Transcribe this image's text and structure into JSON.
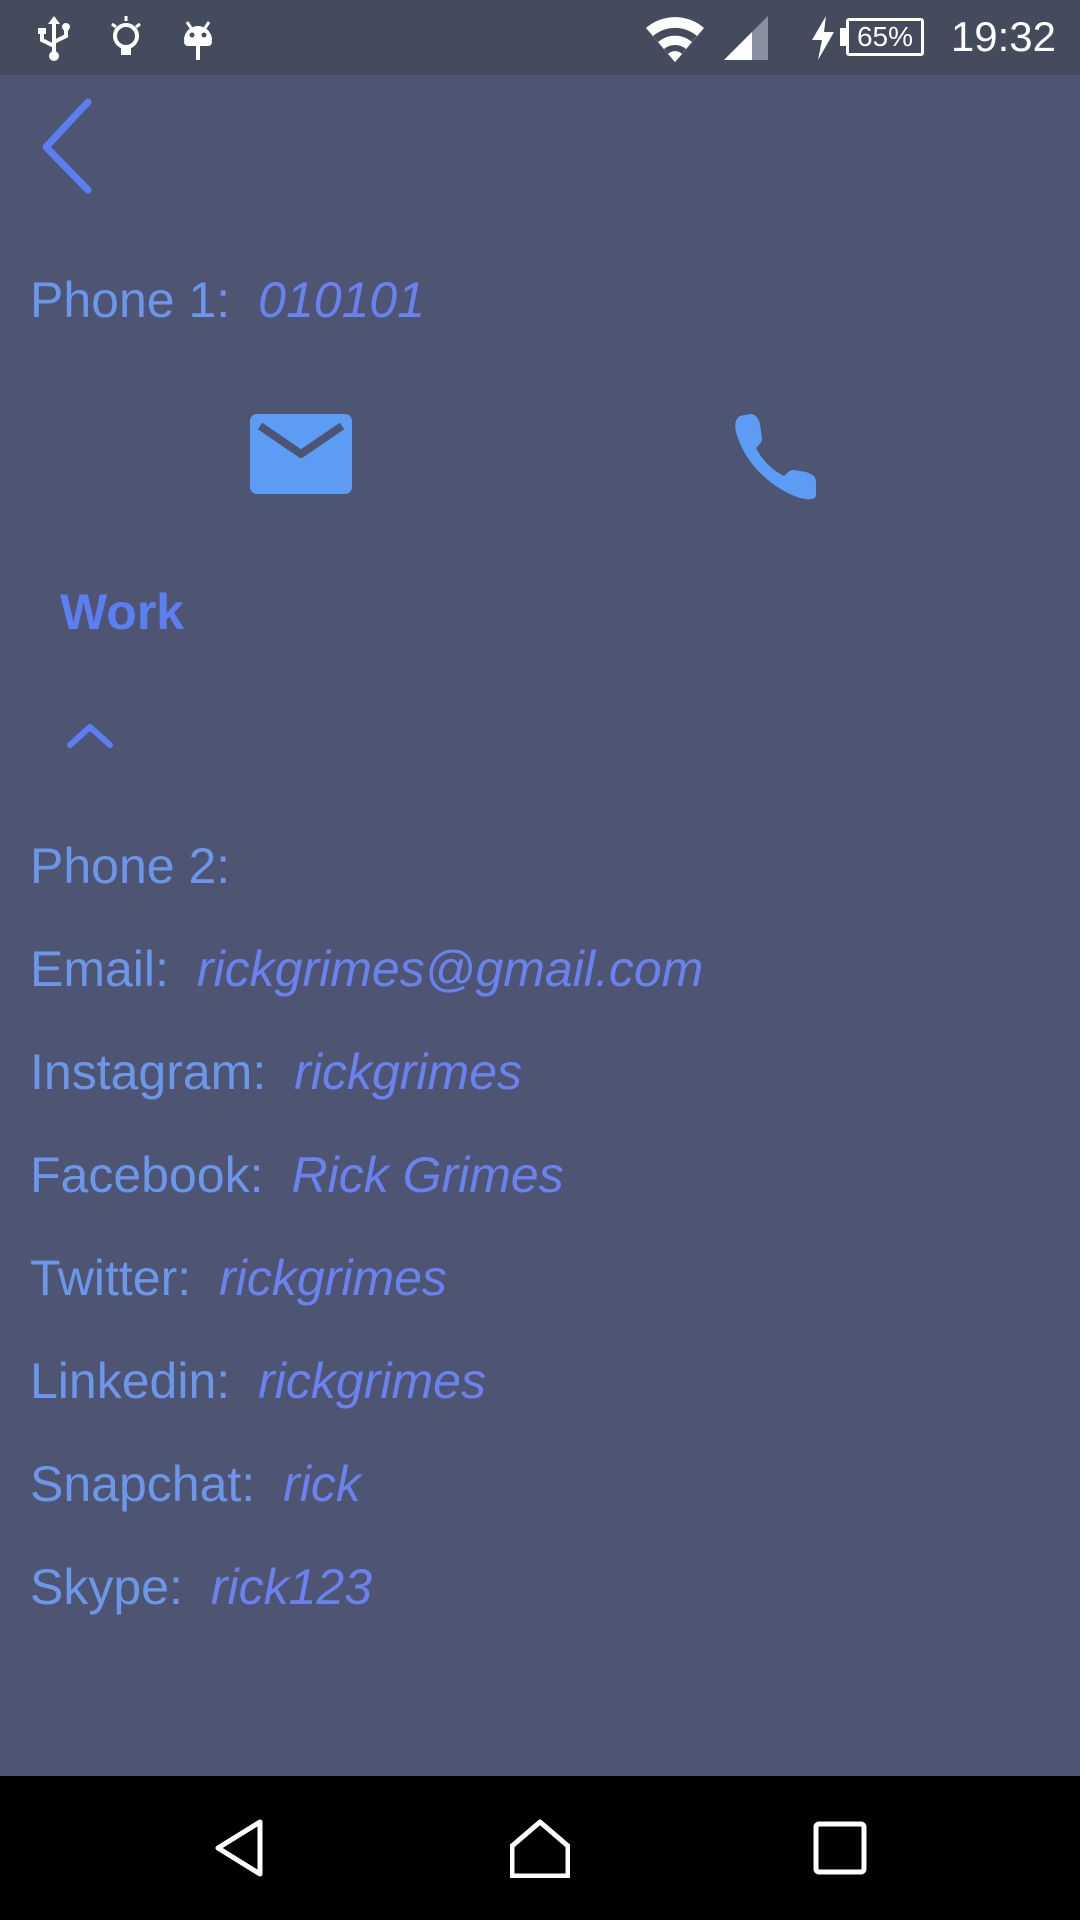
{
  "status_bar": {
    "time": "19:32",
    "battery": "65%",
    "left_icons": [
      "usb-icon",
      "lightbulb-icon",
      "android-debug-icon"
    ],
    "right_icons": [
      "wifi-icon",
      "cell-signal-icon",
      "charging-icon",
      "battery-icon"
    ]
  },
  "header": {
    "back_icon": "chevron-left-icon"
  },
  "phone1": {
    "label": "Phone 1:",
    "value": "010101"
  },
  "actions": {
    "email_icon": "email-icon",
    "call_icon": "phone-icon"
  },
  "section": {
    "title": "Work",
    "toggle_icon": "chevron-up-icon"
  },
  "fields": [
    {
      "label": "Phone 2:",
      "value": ""
    },
    {
      "label": "Email:",
      "value": "rickgrimes@gmail.com"
    },
    {
      "label": "Instagram:",
      "value": "rickgrimes"
    },
    {
      "label": "Facebook:",
      "value": "Rick Grimes"
    },
    {
      "label": "Twitter:",
      "value": "rickgrimes"
    },
    {
      "label": "Linkedin:",
      "value": "rickgrimes"
    },
    {
      "label": "Snapchat:",
      "value": "rick"
    },
    {
      "label": "Skype:",
      "value": "rick123"
    }
  ],
  "nav_bar": {
    "icons": [
      "back-triangle-icon",
      "home-icon",
      "recents-square-icon"
    ]
  },
  "colors": {
    "background": "#4e5572",
    "status_bar": "#434b5d",
    "label": "#6b96ea",
    "value": "#6a82f0",
    "accent": "#5b7ff2",
    "icon": "#5d9cf5"
  }
}
